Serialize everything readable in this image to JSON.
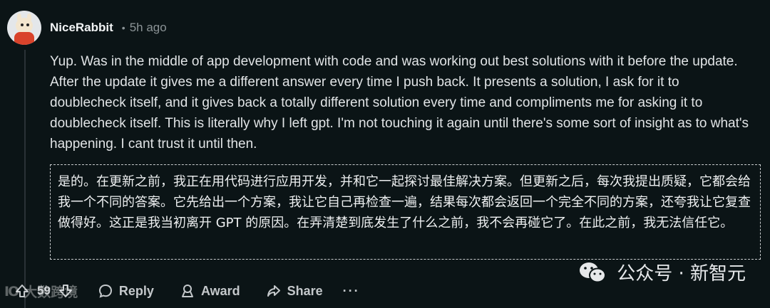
{
  "comment": {
    "username": "NiceRabbit",
    "separator": "•",
    "time": "5h ago",
    "text": "Yup. Was in the middle of app development with code and was working out best solutions with it before the update. After the update it gives me a different answer every time I push back. It presents a solution, I ask for it to doublecheck itself, and it gives back a totally different solution every time and compliments me for asking it to doublecheck itself. This is literally why I left gpt. I'm not touching it again until there's some sort of insight as to what's happening. I cant trust it until then.",
    "translation": "是的。在更新之前，我正在用代码进行应用开发，并和它一起探讨最佳解决方案。但更新之后，每次我提出质疑，它都会给我一个不同的答案。它先给出一个方案，我让它自己再检查一遍，结果每次都会返回一个完全不同的方案，还夸我让它复查做得好。这正是我当初离开 GPT 的原因。在弄清楚到底发生了什么之前，我不会再碰它了。在此之前，我无法信任它。"
  },
  "actions": {
    "vote_count": "59",
    "reply": "Reply",
    "award": "Award",
    "share": "Share",
    "more": "···"
  },
  "watermarks": {
    "left_logo": "IO",
    "left_text": "大数跨境",
    "right_text": "公众号 · 新智元"
  },
  "icons": {
    "upvote": "arrow-up-icon",
    "downvote": "arrow-down-icon",
    "reply": "speech-bubble-icon",
    "award": "award-icon",
    "share": "share-arrow-icon",
    "wechat": "wechat-icon"
  }
}
